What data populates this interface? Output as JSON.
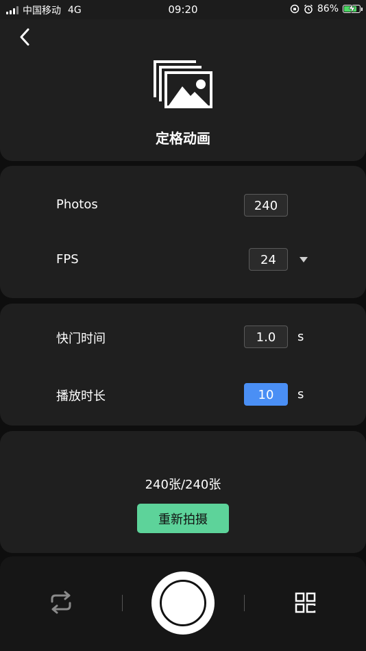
{
  "status_bar": {
    "carrier": "中国移动",
    "network": "4G",
    "time": "09:20",
    "battery_percent": "86%",
    "battery_level": 0.86
  },
  "header": {
    "back_icon": "chevron-left-icon",
    "hero_icon": "photo-stack-icon",
    "title": "定格动画"
  },
  "settings": {
    "photos_label": "Photos",
    "photos_value": "240",
    "fps_label": "FPS",
    "fps_value": "24",
    "shutter_label": "快门时间",
    "shutter_value": "1.0",
    "shutter_unit": "s",
    "duration_label": "播放时长",
    "duration_value": "10",
    "duration_unit": "s"
  },
  "capture": {
    "count": "240张/240张",
    "retake_label": "重新拍摄"
  },
  "bottom_bar": {
    "switch_icon": "repeat-icon",
    "shutter_icon": "shutter-button",
    "grid_icon": "grid-icon"
  },
  "colors": {
    "accent_blue": "#4a8ff5",
    "accent_green": "#5dd39a",
    "card_bg": "#1f1f1f"
  }
}
